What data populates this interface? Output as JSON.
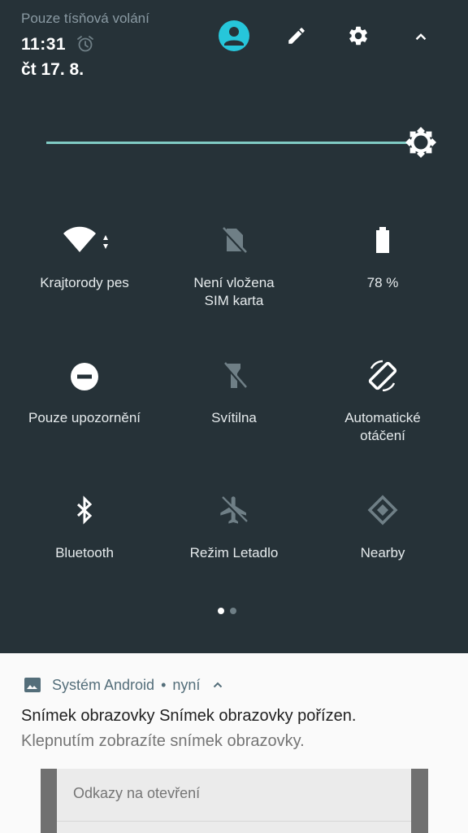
{
  "status": {
    "carrier_text": "Pouze tísňová volání",
    "time": "11:31",
    "date": "čt 17. 8."
  },
  "header_icons": [
    "account-icon",
    "edit-icon",
    "settings-icon",
    "collapse-icon"
  ],
  "brightness": {
    "level": 1.0
  },
  "tiles": [
    {
      "label": "Krajtorody pes",
      "icon": "wifi-icon",
      "active": true
    },
    {
      "label": "Není vložena SIM karta",
      "icon": "no-sim-icon",
      "active": false
    },
    {
      "label": "78 %",
      "icon": "battery-icon",
      "active": true,
      "battery_level": 0.78
    },
    {
      "label": "Pouze upozornění",
      "icon": "do-not-disturb-icon",
      "active": true
    },
    {
      "label": "Svítilna",
      "icon": "flashlight-off-icon",
      "active": false
    },
    {
      "label": "Automatické otáčení",
      "icon": "auto-rotate-icon",
      "active": true
    },
    {
      "label": "Bluetooth",
      "icon": "bluetooth-icon",
      "active": true
    },
    {
      "label": "Režim Letadlo",
      "icon": "airplane-icon",
      "active": false
    },
    {
      "label": "Nearby",
      "icon": "nearby-icon",
      "active": false
    }
  ],
  "pager": {
    "pages": 2,
    "current": 1
  },
  "colors": {
    "panel_bg": "#263238",
    "accent": "#80cbc4",
    "account_icon": "#26c6da",
    "icon_active": "#ffffff",
    "icon_inactive": "#6f7f86"
  },
  "notification": {
    "app_name": "Systém Android",
    "separator": "•",
    "time": "nyní",
    "title": "Snímek obrazovky Snímek obrazovky pořízen.",
    "body": "Klepnutím zobrazíte snímek obrazovky.",
    "links_label": "Odkazy na otevření"
  }
}
